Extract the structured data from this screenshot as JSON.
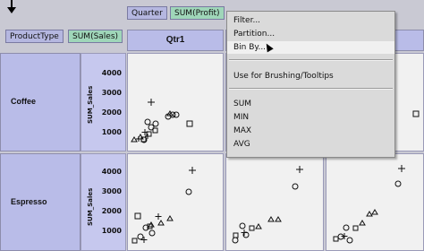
{
  "shelves": {
    "columns": [
      {
        "label": "Quarter",
        "kind": "dimension"
      },
      {
        "label": "SUM(Profit)",
        "kind": "measure"
      }
    ],
    "rows": [
      {
        "label": "ProductType",
        "kind": "dimension"
      },
      {
        "label": "SUM(Sales)",
        "kind": "measure"
      }
    ]
  },
  "column_header": {
    "label": "Qtr1"
  },
  "row_headers": [
    {
      "label": "Coffee",
      "y_axis_title": "SUM_Sales",
      "ticks": [
        "4000",
        "3000",
        "2000",
        "1000"
      ]
    },
    {
      "label": "Espresso",
      "y_axis_title": "SUM_Sales",
      "ticks": [
        "4000",
        "3000",
        "2000",
        "1000"
      ]
    }
  ],
  "context_menu": {
    "items": [
      {
        "label": "Filter..."
      },
      {
        "label": "Partition..."
      },
      {
        "label": "Bin By...",
        "highlighted": true
      },
      {
        "label": "Use for Brushing/Tooltips"
      },
      {
        "label": "SUM"
      },
      {
        "label": "MIN"
      },
      {
        "label": "MAX"
      },
      {
        "label": "AVG"
      }
    ]
  },
  "colors": {
    "dimension_pill": "#b5b7e0",
    "measure_pill": "#9fd6b9",
    "header": "#b9bce8",
    "plot_bg": "#f1f1f1",
    "menu_bg": "#dadada"
  },
  "marks": {
    "cross": "cross-icon",
    "circle": "circle-icon",
    "square": "square-icon",
    "triangle": "triangle-icon"
  }
}
